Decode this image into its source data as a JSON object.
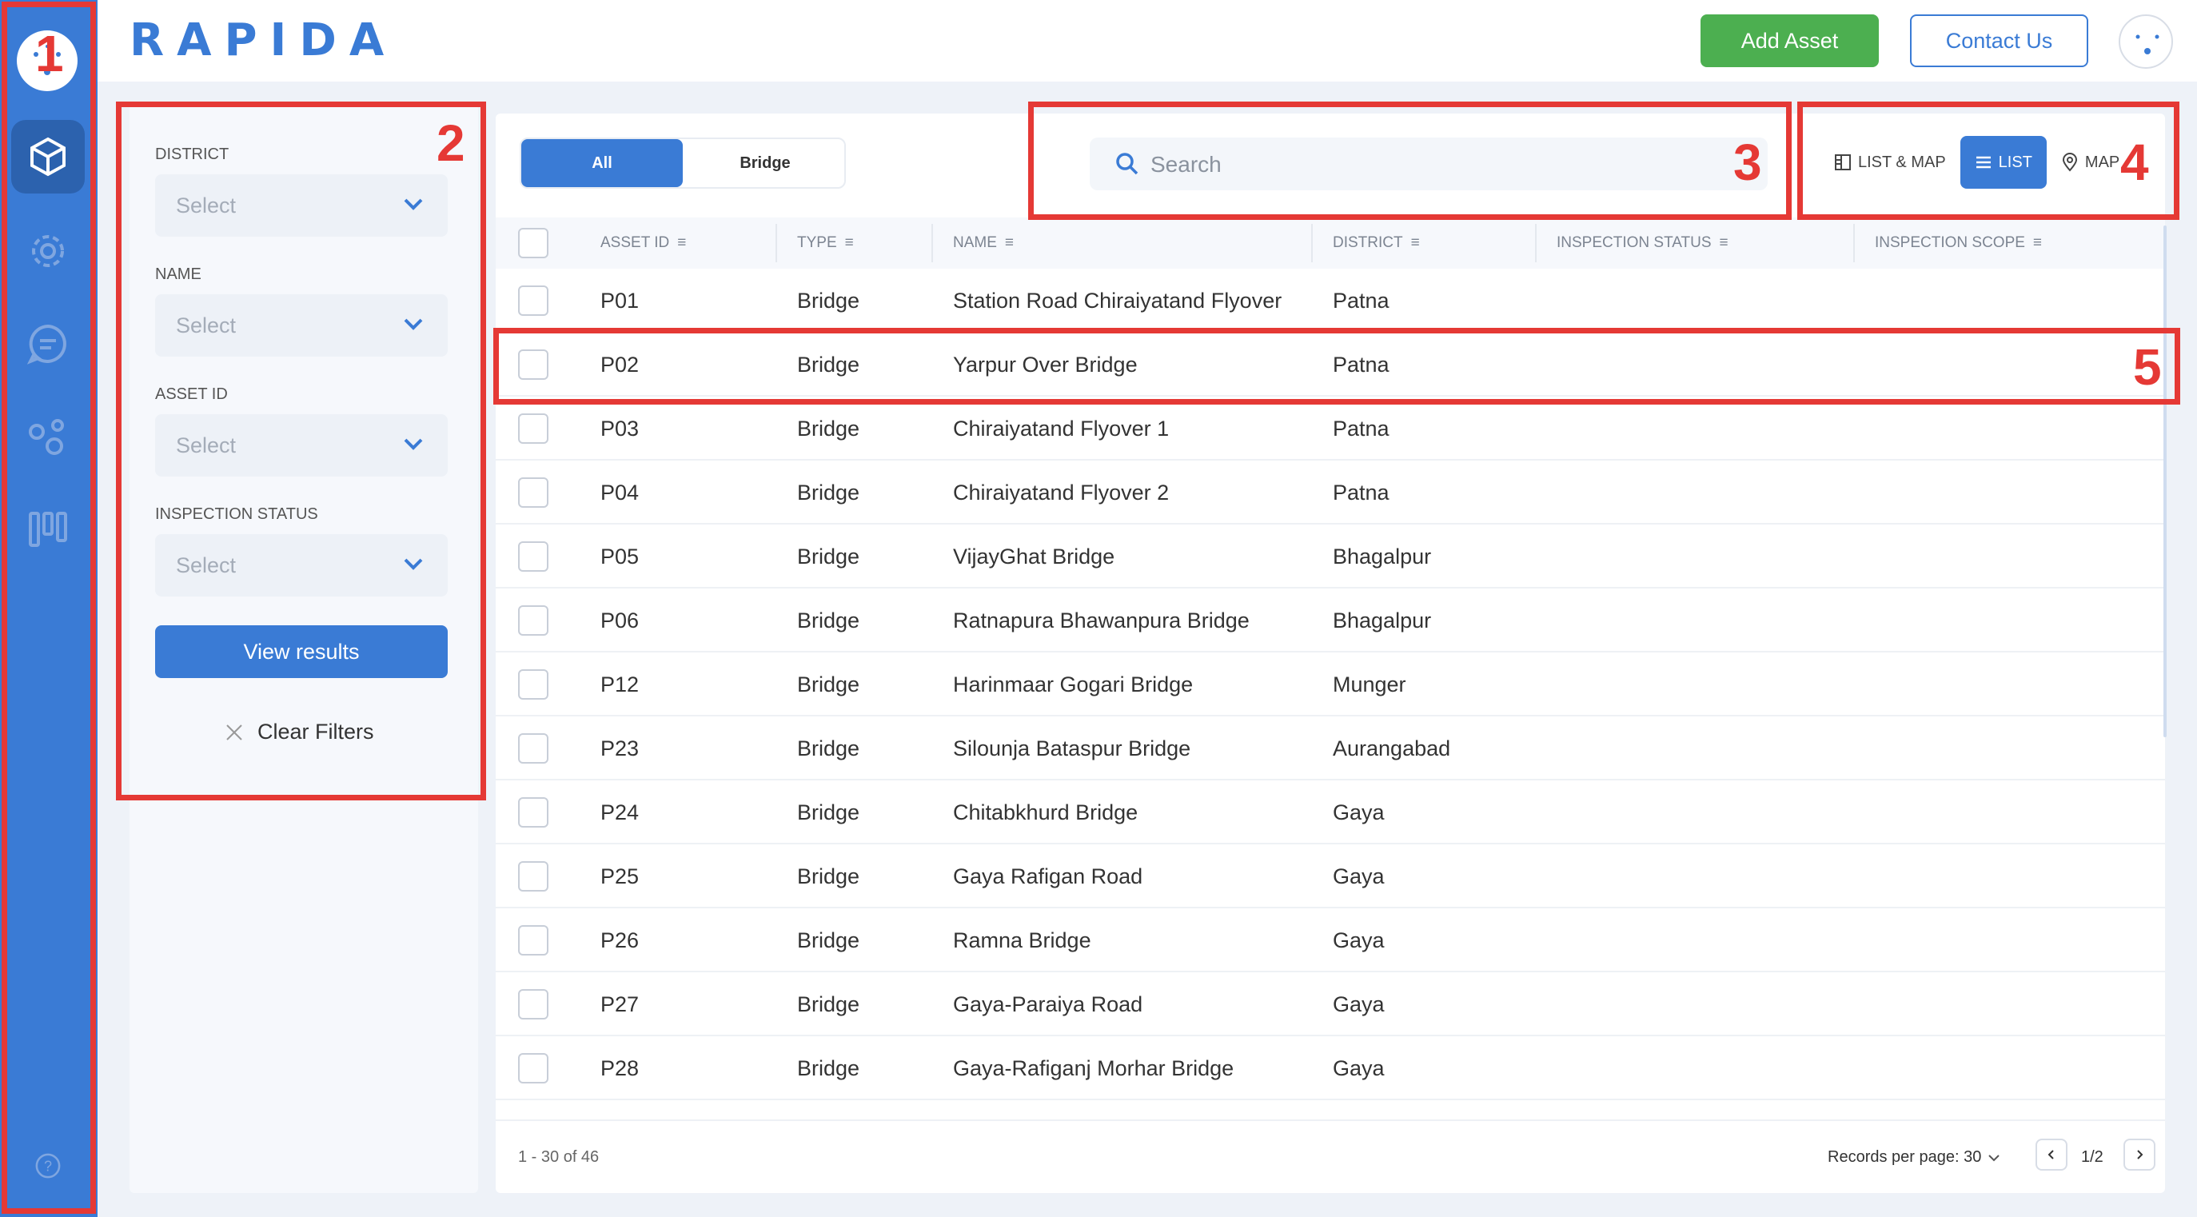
{
  "app": {
    "brand": "RAPIDA"
  },
  "header": {
    "add_asset": "Add Asset",
    "contact_us": "Contact Us"
  },
  "sidebar": {
    "items": [
      {
        "icon": "assets-cube-icon",
        "active": true
      },
      {
        "icon": "settings-gear-icon",
        "active": false
      },
      {
        "icon": "chat-icon",
        "active": false
      },
      {
        "icon": "network-nodes-icon",
        "active": false
      },
      {
        "icon": "kanban-columns-icon",
        "active": false
      }
    ],
    "help_icon": "help-circle-icon"
  },
  "filters": {
    "fields": [
      {
        "label": "DISTRICT",
        "placeholder": "Select"
      },
      {
        "label": "NAME",
        "placeholder": "Select"
      },
      {
        "label": "ASSET ID",
        "placeholder": "Select"
      },
      {
        "label": "INSPECTION STATUS",
        "placeholder": "Select"
      }
    ],
    "view_results": "View results",
    "clear_filters": "Clear Filters"
  },
  "segments": {
    "all": "All",
    "bridge": "Bridge",
    "selected": "All"
  },
  "search": {
    "placeholder": "Search"
  },
  "view_toggle": {
    "list_map": "LIST & MAP",
    "list": "LIST",
    "map": "MAP",
    "selected": "LIST"
  },
  "table": {
    "columns": [
      "ASSET ID",
      "TYPE",
      "NAME",
      "DISTRICT",
      "INSPECTION STATUS",
      "INSPECTION SCOPE"
    ],
    "rows": [
      {
        "id": "P01",
        "type": "Bridge",
        "name": "Station Road Chiraiyatand Flyover",
        "district": "Patna"
      },
      {
        "id": "P02",
        "type": "Bridge",
        "name": "Yarpur Over Bridge",
        "district": "Patna"
      },
      {
        "id": "P03",
        "type": "Bridge",
        "name": "Chiraiyatand Flyover 1",
        "district": "Patna"
      },
      {
        "id": "P04",
        "type": "Bridge",
        "name": "Chiraiyatand Flyover 2",
        "district": "Patna"
      },
      {
        "id": "P05",
        "type": "Bridge",
        "name": "VijayGhat Bridge",
        "district": "Bhagalpur"
      },
      {
        "id": "P06",
        "type": "Bridge",
        "name": "Ratnapura Bhawanpura Bridge",
        "district": "Bhagalpur"
      },
      {
        "id": "P12",
        "type": "Bridge",
        "name": "Harinmaar Gogari Bridge",
        "district": "Munger"
      },
      {
        "id": "P23",
        "type": "Bridge",
        "name": "Silounja Bataspur Bridge",
        "district": "Aurangabad"
      },
      {
        "id": "P24",
        "type": "Bridge",
        "name": "Chitabkhurd Bridge",
        "district": "Gaya"
      },
      {
        "id": "P25",
        "type": "Bridge",
        "name": "Gaya Rafigan Road",
        "district": "Gaya"
      },
      {
        "id": "P26",
        "type": "Bridge",
        "name": "Ramna Bridge",
        "district": "Gaya"
      },
      {
        "id": "P27",
        "type": "Bridge",
        "name": "Gaya-Paraiya Road",
        "district": "Gaya"
      },
      {
        "id": "P28",
        "type": "Bridge",
        "name": "Gaya-Rafiganj Morhar Bridge",
        "district": "Gaya"
      }
    ]
  },
  "footer": {
    "count": "1 - 30 of 46",
    "records_per_page": "Records per page: 30",
    "page": "1/2"
  },
  "annotations": [
    "1",
    "2",
    "3",
    "4",
    "5"
  ],
  "colors": {
    "primary": "#3a7bd5",
    "success": "#4caf50",
    "annotation": "#e53935"
  }
}
